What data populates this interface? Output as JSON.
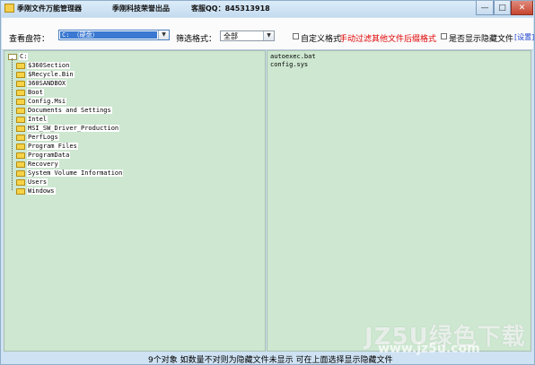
{
  "window": {
    "title": "季刚文件万能管理器",
    "subtitle": "季刚科技荣誉出品",
    "qq_label": "客服QQ：845313918",
    "min_glyph": "—",
    "max_glyph": "□",
    "close_glyph": "✕"
  },
  "toolbar": {
    "drive_label": "查看盘符：",
    "drive_value": "C:  （硬盘）",
    "filter_label": "筛选格式：",
    "filter_value": "全部",
    "custom_format_label": "自定义格式",
    "manual_filter_hint": "手动过滤其他文件后缀格式",
    "show_hidden_label": "是否显示隐藏文件",
    "settings_link": "[设置]",
    "combo_arrow_glyph": "▼"
  },
  "tree": {
    "root": "C:",
    "folders": [
      "$360Section",
      "$Recycle.Bin",
      "360SANDBOX",
      "Boot",
      "Config.Msi",
      "Documents and Settings",
      "Intel",
      "MSI_SW_Driver_Production",
      "PerfLogs",
      "Program Files",
      "ProgramData",
      "Recovery",
      "System Volume Information",
      "Users",
      "Windows"
    ]
  },
  "files": [
    "autoexec.bat",
    "config.sys"
  ],
  "status": {
    "text": "9个对象   如数量不对则为隐藏文件未显示   可在上面选择显示隐藏文件"
  },
  "watermark": {
    "main": "JZ5U绿色下载",
    "sub": "www.jz5u.com"
  },
  "colors": {
    "pane_bg": "#cde7d0",
    "window_bg": "#cfe2f3",
    "hint_red": "#e00000",
    "link_blue": "#1a3fd0",
    "selection_blue": "#3a78d1"
  },
  "icons": {
    "app": "folder-app-icon",
    "folder": "folder-icon",
    "open_folder": "open-folder-icon"
  }
}
